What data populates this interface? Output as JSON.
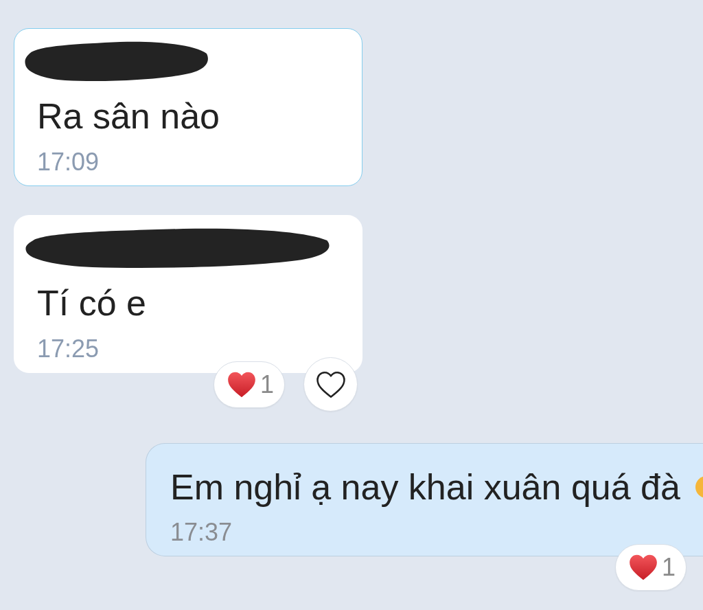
{
  "messages": [
    {
      "kind": "incoming",
      "sender_redacted": true,
      "highlighted": true,
      "text": "Ra sân nào",
      "time": "17:09"
    },
    {
      "kind": "incoming",
      "sender_redacted": true,
      "highlighted": false,
      "text": "Tí có e",
      "time": "17:25",
      "reaction": {
        "count": "1"
      },
      "react_button": true
    },
    {
      "kind": "outgoing",
      "highlighted": false,
      "text": "Em nghỉ ạ nay khai xuân quá đà",
      "trailing_emoji": true,
      "time": "17:37",
      "reaction": {
        "count": "1"
      }
    }
  ]
}
